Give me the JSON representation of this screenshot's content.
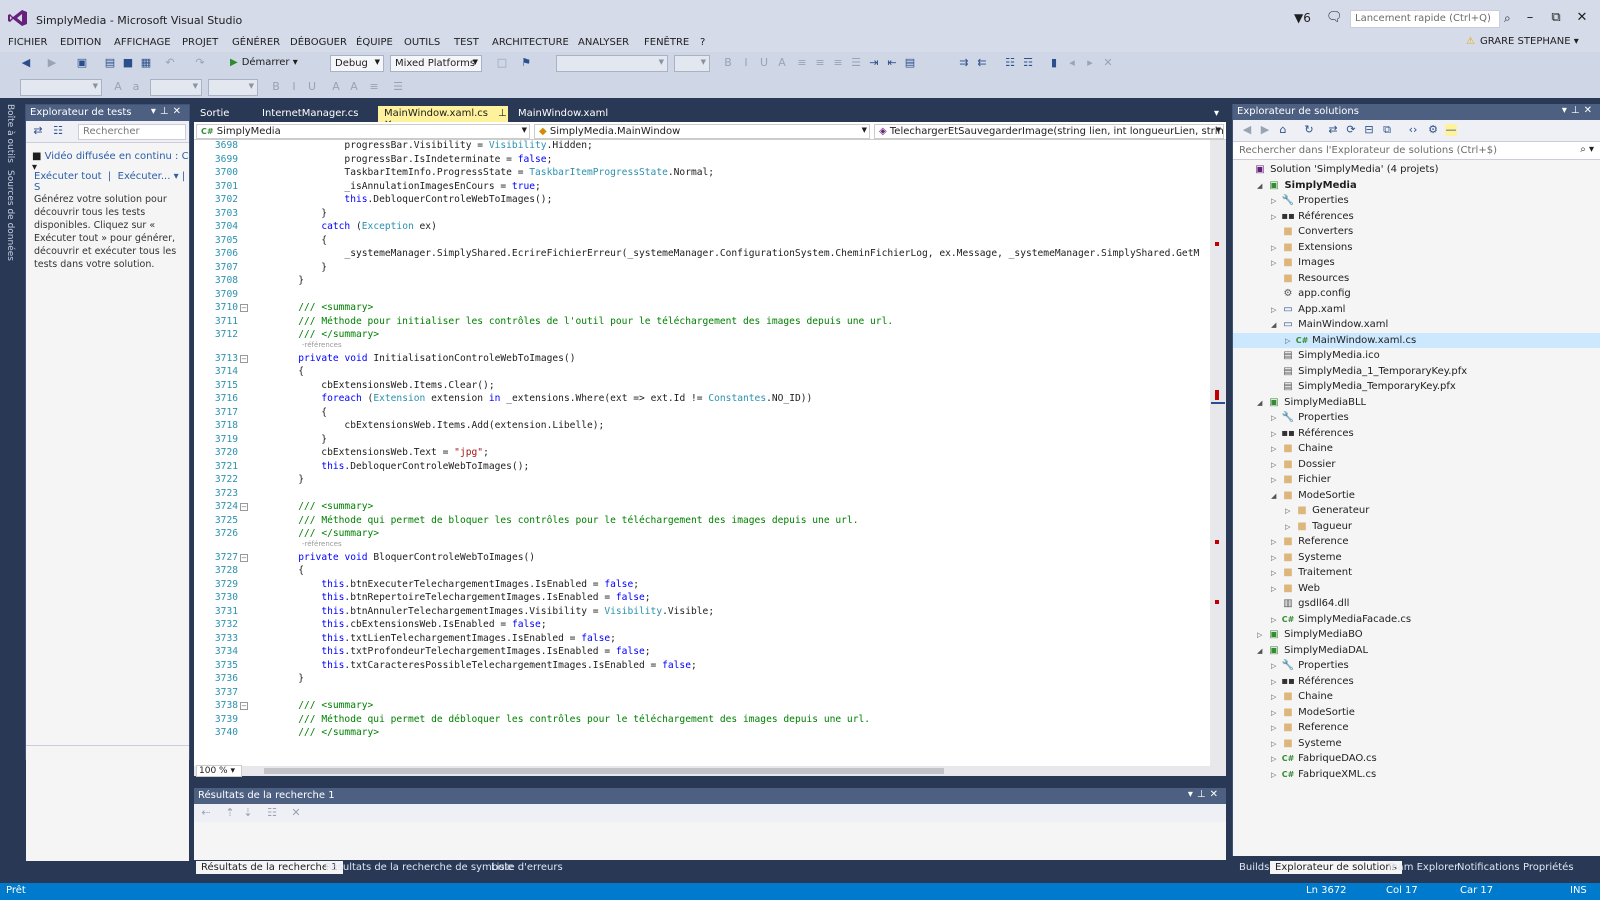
{
  "window": {
    "title": "SimplyMedia - Microsoft Visual Studio",
    "flag_count": "6",
    "quick_launch": "Lancement rapide (Ctrl+Q)",
    "user": "GRARE STEPHANE"
  },
  "menu": [
    "FICHIER",
    "EDITION",
    "AFFICHAGE",
    "PROJET",
    "GÉNÉRER",
    "DÉBOGUER",
    "ÉQUIPE",
    "OUTILS",
    "TEST",
    "ARCHITECTURE",
    "ANALYSER",
    "FENÊTRE",
    "?"
  ],
  "toolbar": {
    "start": "Démarrer",
    "config": "Debug",
    "platform": "Mixed Platforms"
  },
  "left_strip": {
    "toolbox": "Boîte à outils",
    "sources": "Sources de données"
  },
  "test_explorer": {
    "title": "Explorateur de tests",
    "search": "Rechercher",
    "video": "Vidéo diffusée en continu : C",
    "run_all": "Exécuter tout",
    "run": "Exécuter...",
    "message": "Générez votre solution pour découvrir tous les tests disponibles. Cliquez sur « Exécuter tout » pour générer, découvrir et exécuter tous les tests dans votre solution."
  },
  "tabs": [
    {
      "label": "Sortie"
    },
    {
      "label": "InternetManager.cs"
    },
    {
      "label": "MainWindow.xaml.cs"
    },
    {
      "label": "MainWindow.xaml"
    }
  ],
  "nav": {
    "project": "SimplyMedia",
    "class": "SimplyMedia.MainWindow",
    "member": "TelechargerEtSauvegarderImage(string lien, int longueurLien, string ext"
  },
  "zoom": "100 %",
  "code": [
    {
      "n": "3698",
      "t": "                progressBar.Visibility = Visibility.Hidden;"
    },
    {
      "n": "3699",
      "t": "                progressBar.IsIndeterminate = false;"
    },
    {
      "n": "3700",
      "t": "                TaskbarItemInfo.ProgressState = TaskbarItemProgressState.Normal;"
    },
    {
      "n": "3701",
      "t": "                _isAnnulationImagesEnCours = true;"
    },
    {
      "n": "3702",
      "t": "                this.DebloquerControleWebToImages();"
    },
    {
      "n": "3703",
      "t": "            }"
    },
    {
      "n": "3704",
      "t": "            catch (Exception ex)"
    },
    {
      "n": "3705",
      "t": "            {"
    },
    {
      "n": "3706",
      "t": "                _systemeManager.SimplyShared.EcrireFichierErreur(_systemeManager.ConfigurationSystem.CheminFichierLog, ex.Message, _systemeManager.SimplyShared.GetM"
    },
    {
      "n": "3707",
      "t": "            }"
    },
    {
      "n": "3708",
      "t": "        }"
    },
    {
      "n": "3709",
      "t": ""
    },
    {
      "n": "3710",
      "t": "        /// <summary>"
    },
    {
      "n": "3711",
      "t": "        /// Méthode pour initialiser les contrôles de l'outil pour le téléchargement des images depuis une url."
    },
    {
      "n": "3712",
      "t": "        /// </summary>"
    },
    {
      "n": "3713",
      "t": "        private void InitialisationControleWebToImages()"
    },
    {
      "n": "3714",
      "t": "        {"
    },
    {
      "n": "3715",
      "t": "            cbExtensionsWeb.Items.Clear();"
    },
    {
      "n": "3716",
      "t": "            foreach (Extension extension in _extensions.Where(ext => ext.Id != Constantes.NO_ID))"
    },
    {
      "n": "3717",
      "t": "            {"
    },
    {
      "n": "3718",
      "t": "                cbExtensionsWeb.Items.Add(extension.Libelle);"
    },
    {
      "n": "3719",
      "t": "            }"
    },
    {
      "n": "3720",
      "t": "            cbExtensionsWeb.Text = \"jpg\";"
    },
    {
      "n": "3721",
      "t": "            this.DebloquerControleWebToImages();"
    },
    {
      "n": "3722",
      "t": "        }"
    },
    {
      "n": "3723",
      "t": ""
    },
    {
      "n": "3724",
      "t": "        /// <summary>"
    },
    {
      "n": "3725",
      "t": "        /// Méthode qui permet de bloquer les contrôles pour le téléchargement des images depuis une url."
    },
    {
      "n": "3726",
      "t": "        /// </summary>"
    },
    {
      "n": "3727",
      "t": "        private void BloquerControleWebToImages()"
    },
    {
      "n": "3728",
      "t": "        {"
    },
    {
      "n": "3729",
      "t": "            this.btnExecuterTelechargementImages.IsEnabled = false;"
    },
    {
      "n": "3730",
      "t": "            this.btnRepertoireTelechargementImages.IsEnabled = false;"
    },
    {
      "n": "3731",
      "t": "            this.btnAnnulerTelechargementImages.Visibility = Visibility.Visible;"
    },
    {
      "n": "3732",
      "t": "            this.cbExtensionsWeb.IsEnabled = false;"
    },
    {
      "n": "3733",
      "t": "            this.txtLienTelechargementImages.IsEnabled = false;"
    },
    {
      "n": "3734",
      "t": "            this.txtProfondeurTelechargementImages.IsEnabled = false;"
    },
    {
      "n": "3735",
      "t": "            this.txtCaracteresPossibleTelechargementImages.IsEnabled = false;"
    },
    {
      "n": "3736",
      "t": "        }"
    },
    {
      "n": "3737",
      "t": ""
    },
    {
      "n": "3738",
      "t": "        /// <summary>"
    },
    {
      "n": "3739",
      "t": "        /// Méthode qui permet de débloquer les contrôles pour le téléchargement des images depuis une url."
    },
    {
      "n": "3740",
      "t": "        /// </summary>"
    }
  ],
  "refs_label": "-références",
  "results": {
    "title": "Résultats de la recherche 1",
    "tabs": [
      "Résultats de la recherche 1",
      "Résultats de la recherche de symbole",
      "Liste d'erreurs"
    ]
  },
  "solution_explorer": {
    "title": "Explorateur de solutions",
    "search": "Rechercher dans l'Explorateur de solutions (Ctrl+$)",
    "items": [
      {
        "label": "Solution 'SimplyMedia' (4 projets)",
        "icon": "solution-icon"
      },
      {
        "label": "SimplyMedia",
        "icon": "project-icon"
      },
      {
        "label": "Properties",
        "icon": "wrench-icon"
      },
      {
        "label": "Références",
        "icon": "references-icon"
      },
      {
        "label": "Converters",
        "icon": "folder-icon"
      },
      {
        "label": "Extensions",
        "icon": "folder-icon"
      },
      {
        "label": "Images",
        "icon": "folder-icon"
      },
      {
        "label": "Resources",
        "icon": "folder-icon"
      },
      {
        "label": "app.config",
        "icon": "config-icon"
      },
      {
        "label": "App.xaml",
        "icon": "xaml-icon"
      },
      {
        "label": "MainWindow.xaml",
        "icon": "xaml-icon"
      },
      {
        "label": "MainWindow.xaml.cs",
        "icon": "csharp-icon"
      },
      {
        "label": "SimplyMedia.ico",
        "icon": "file-icon"
      },
      {
        "label": "SimplyMedia_1_TemporaryKey.pfx",
        "icon": "file-icon"
      },
      {
        "label": "SimplyMedia_TemporaryKey.pfx",
        "icon": "file-icon"
      },
      {
        "label": "SimplyMediaBLL",
        "icon": "project-icon"
      },
      {
        "label": "Properties",
        "icon": "wrench-icon"
      },
      {
        "label": "Références",
        "icon": "references-icon"
      },
      {
        "label": "Chaine",
        "icon": "folder-icon"
      },
      {
        "label": "Dossier",
        "icon": "folder-icon"
      },
      {
        "label": "Fichier",
        "icon": "folder-icon"
      },
      {
        "label": "ModeSortie",
        "icon": "folder-icon"
      },
      {
        "label": "Generateur",
        "icon": "folder-icon"
      },
      {
        "label": "Tagueur",
        "icon": "folder-icon"
      },
      {
        "label": "Reference",
        "icon": "folder-icon"
      },
      {
        "label": "Systeme",
        "icon": "folder-icon"
      },
      {
        "label": "Traitement",
        "icon": "folder-icon"
      },
      {
        "label": "Web",
        "icon": "folder-icon"
      },
      {
        "label": "gsdll64.dll",
        "icon": "dll-icon"
      },
      {
        "label": "SimplyMediaFacade.cs",
        "icon": "csharp-icon"
      },
      {
        "label": "SimplyMediaBO",
        "icon": "project-icon"
      },
      {
        "label": "SimplyMediaDAL",
        "icon": "project-icon"
      },
      {
        "label": "Properties",
        "icon": "wrench-icon"
      },
      {
        "label": "Références",
        "icon": "references-icon"
      },
      {
        "label": "Chaine",
        "icon": "folder-icon"
      },
      {
        "label": "ModeSortie",
        "icon": "folder-icon"
      },
      {
        "label": "Reference",
        "icon": "folder-icon"
      },
      {
        "label": "Systeme",
        "icon": "folder-icon"
      },
      {
        "label": "FabriqueDAO.cs",
        "icon": "csharp-icon"
      },
      {
        "label": "FabriqueXML.cs",
        "icon": "csharp-icon"
      }
    ],
    "bottom_tabs": [
      "Builds",
      "Explorateur de solutions",
      "Team Explorer",
      "Notifications",
      "Propriétés"
    ]
  },
  "status": {
    "ready": "Prêt",
    "line": "Ln 3672",
    "col": "Col 17",
    "car": "Car 17",
    "mode": "INS"
  }
}
